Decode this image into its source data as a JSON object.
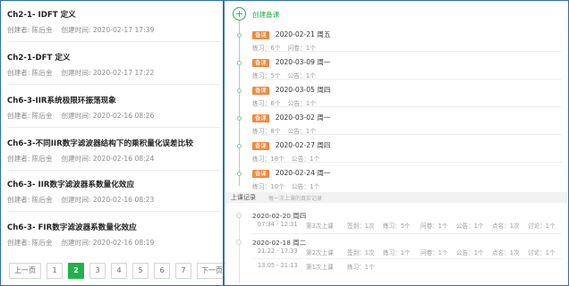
{
  "courses": [
    {
      "title": "Ch2-1- IDFT 定义",
      "creator": "创建者: 陈后金",
      "time": "创建时间: 2020-02-17 17:39"
    },
    {
      "title": "Ch2-1-DFT 定义",
      "creator": "创建者: 陈后金",
      "time": "创建时间: 2020-02-17 17:22"
    },
    {
      "title": "Ch6-3-IIR系统极限环振荡现象",
      "creator": "创建者: 陈后金",
      "time": "创建时间: 2020-02-16 08:26"
    },
    {
      "title": "Ch6-3-不同IIR数字滤波器结构下的乘积量化误差比较",
      "creator": "创建者: 陈后金",
      "time": "创建时间: 2020-02-16 08:24"
    },
    {
      "title": "Ch6-3- IIR数字滤波器系数量化效应",
      "creator": "创建者: 陈后金",
      "time": "创建时间: 2020-02-16 08:23"
    },
    {
      "title": "Ch6-3- FIR数字滤波器系数量化效应",
      "creator": "创建者: 陈后金",
      "time": "创建时间: 2020-02-16 08:19"
    }
  ],
  "pager": {
    "prev": "上一页",
    "next": "下一页",
    "pages": [
      "1",
      "2",
      "3",
      "4",
      "5",
      "6",
      "7"
    ],
    "current": "2"
  },
  "create_label": "创建备课",
  "entries": [
    {
      "tag": "备课",
      "date": "2020-02-21 周五",
      "stats": [
        "练习：6个",
        "问卷：1个"
      ]
    },
    {
      "tag": "备课",
      "date": "2020-03-09 周一",
      "stats": [
        "练习：5个",
        "公告：1个"
      ]
    },
    {
      "tag": "备课",
      "date": "2020-03-05 周四",
      "stats": [
        "练习：6个",
        "公告：1个"
      ]
    },
    {
      "tag": "备课",
      "date": "2020-03-02 周一",
      "stats": [
        "练习：8个",
        "公告：1个"
      ]
    },
    {
      "tag": "备课",
      "date": "2020-02-27 周四",
      "stats": [
        "练习：18个",
        "公告：1个"
      ]
    },
    {
      "tag": "备课",
      "date": "2020-02-24 周一",
      "stats": [
        "练习：10个",
        "公告：1个"
      ]
    }
  ],
  "record_bar": {
    "title": "上课记录",
    "subtitle": "每一次上课的真实记录"
  },
  "records": [
    {
      "date": "2020-02-20 周四",
      "rows": [
        {
          "time": "07:34 - 12:31",
          "class": "第3次上课",
          "sign": "签到：1次",
          "exercise": "练习：5个",
          "survey": "问卷：1个",
          "notice": "公告：1个",
          "call": "点名：1次",
          "discuss": "讨论：1个"
        }
      ]
    },
    {
      "date": "2020-02-18 周二",
      "rows": [
        {
          "time": "21:22 - 17:33",
          "class": "第2次上课",
          "sign": "签到：1次",
          "exercise": "练习：1个",
          "survey": "问卷：1个",
          "notice": "公告：1个",
          "call": "点名：1次",
          "discuss": "讨论：1个"
        },
        {
          "time": "13:05 - 21:13",
          "class": "第1次上课",
          "sign": "练习：1个",
          "exercise": "",
          "survey": "",
          "notice": "",
          "call": "",
          "discuss": ""
        }
      ]
    }
  ],
  "colors": {
    "accent": "#22b14c",
    "tag": "#f08a3e",
    "frame": "#2f6fb3"
  }
}
